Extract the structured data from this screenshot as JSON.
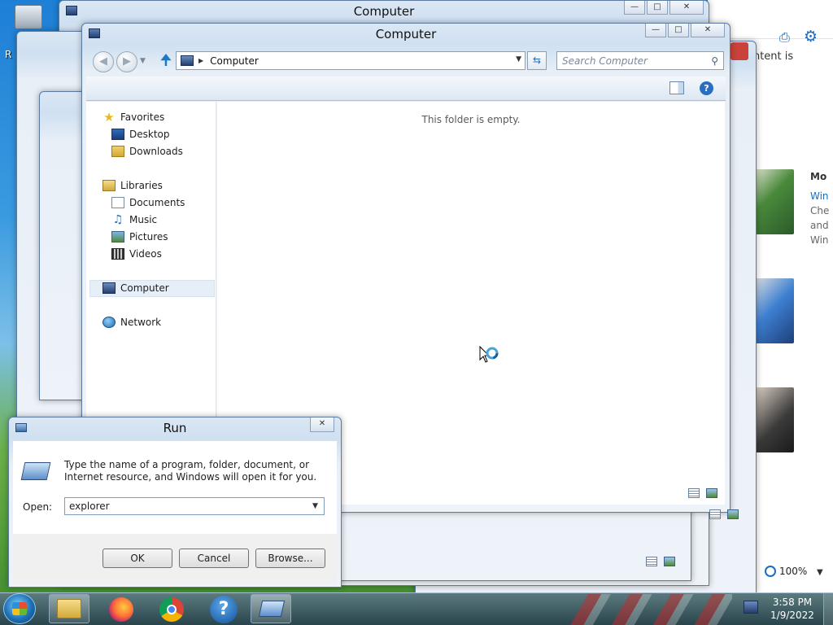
{
  "desktop": {
    "recycle_bin_label": "R"
  },
  "background_browser": {
    "content_text": "ontent is",
    "headline": "Mo",
    "lines": [
      "Win",
      "Che",
      "and",
      "Win"
    ],
    "zoom": "100%",
    "colors": {
      "accent": "#1b6cc0"
    }
  },
  "windows": {
    "back1_title": "Computer",
    "main_title": "Computer"
  },
  "explorer": {
    "address": "Computer",
    "search_placeholder": "Search Computer",
    "empty_message": "This folder is empty.",
    "nav": {
      "favorites": "Favorites",
      "desktop": "Desktop",
      "downloads": "Downloads",
      "libraries": "Libraries",
      "documents": "Documents",
      "music": "Music",
      "pictures": "Pictures",
      "videos": "Videos",
      "computer": "Computer",
      "network": "Network"
    }
  },
  "run": {
    "title": "Run",
    "description": "Type the name of a program, folder, document, or Internet resource, and Windows will open it for you.",
    "open_label": "Open:",
    "open_value": "explorer",
    "ok_label": "OK",
    "cancel_label": "Cancel",
    "browse_label": "Browse..."
  },
  "taskbar": {
    "time": "3:58 PM",
    "date": "1/9/2022"
  }
}
